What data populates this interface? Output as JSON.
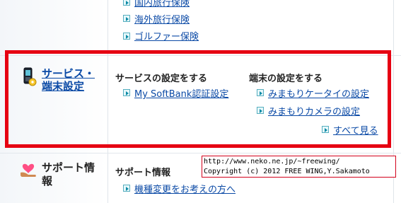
{
  "insurance_links": [
    {
      "label": "国内旅行保険"
    },
    {
      "label": "海外旅行保険"
    },
    {
      "label": "ゴルファー保険"
    }
  ],
  "service_section": {
    "title": "サービス・端末設定",
    "service_heading": "サービスの設定をする",
    "service_links": [
      {
        "label": "My SoftBank認証設定"
      }
    ],
    "device_heading": "端末の設定をする",
    "device_links": [
      {
        "label": "みまもりケータイの設定"
      },
      {
        "label": "みまもりカメラの設定"
      }
    ],
    "see_all": "すべて見る"
  },
  "support_section": {
    "title": "サポート情報",
    "heading": "サポート情報",
    "links": [
      {
        "label": "機種変更をお考えの方へ"
      }
    ]
  },
  "copyright": {
    "line1": "http://www.neko.ne.jp/~freewing/",
    "line2": "Copyright (c) 2012 FREE WING,Y.Sakamoto"
  },
  "colors": {
    "link": "#0b4aa6",
    "highlight_border": "#e60012",
    "accent": "#0d8aa5"
  }
}
